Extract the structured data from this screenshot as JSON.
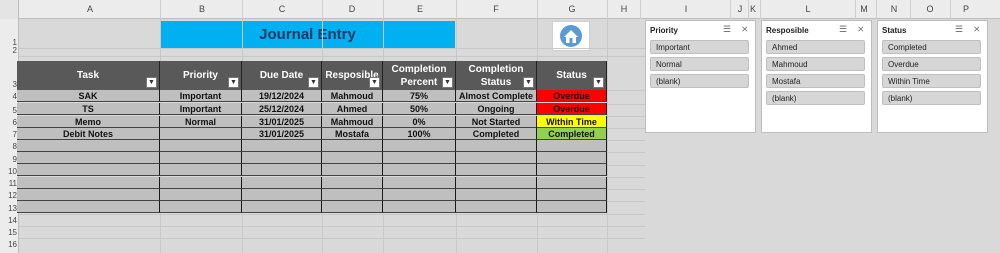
{
  "columns": [
    "A",
    "B",
    "C",
    "D",
    "E",
    "F",
    "G",
    "H",
    "I",
    "J",
    "K",
    "L",
    "M",
    "N",
    "O",
    "P"
  ],
  "rows": [
    "1",
    "2",
    "3",
    "4",
    "5",
    "6",
    "7",
    "8",
    "9",
    "10",
    "11",
    "12",
    "13",
    "14",
    "15",
    "16"
  ],
  "title": "Journal Entry",
  "home_icon": "home-icon",
  "table": {
    "headers": [
      "Task",
      "Priority",
      "Due Date",
      "Resposible",
      "Completion Percent",
      "Completion Status",
      "Status"
    ],
    "rows": [
      {
        "task": "SAK",
        "priority": "Important",
        "due": "19/12/2024",
        "resp": "Mahmoud",
        "pct": "75%",
        "cstatus": "Almost Complete",
        "status": "Overdue",
        "status_color": "#ff0000"
      },
      {
        "task": "TS",
        "priority": "Important",
        "due": "25/12/2024",
        "resp": "Ahmed",
        "pct": "50%",
        "cstatus": "Ongoing",
        "status": "Overdue",
        "status_color": "#ff0000"
      },
      {
        "task": "Memo",
        "priority": "Normal",
        "due": "31/01/2025",
        "resp": "Mahmoud",
        "pct": "0%",
        "cstatus": "Not Started",
        "status": "Within Time",
        "status_color": "#ffff00"
      },
      {
        "task": "Debit Notes",
        "priority": "",
        "due": "31/01/2025",
        "resp": "Mostafa",
        "pct": "100%",
        "cstatus": "Completed",
        "status": "Completed",
        "status_color": "#92d050"
      }
    ]
  },
  "slicers": [
    {
      "title": "Priority",
      "items": [
        "Important",
        "Normal",
        "(blank)"
      ]
    },
    {
      "title": "Resposible",
      "items": [
        "Ahmed",
        "Mahmoud",
        "Mostafa",
        "(blank)"
      ]
    },
    {
      "title": "Status",
      "items": [
        "Completed",
        "Overdue",
        "Within Time",
        "(blank)"
      ]
    }
  ],
  "colors": {
    "header": "#595959",
    "cell": "#bfbfbf",
    "title_bg": "#00b0f0",
    "title_text": "#1f3864"
  }
}
